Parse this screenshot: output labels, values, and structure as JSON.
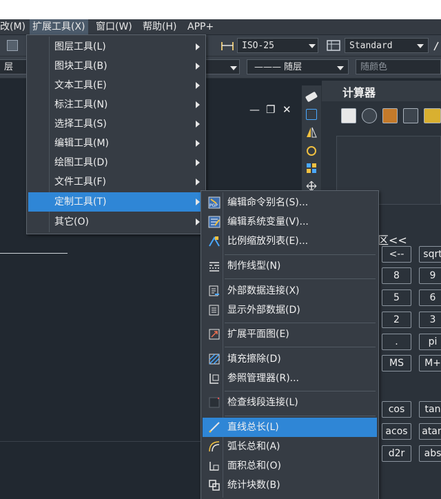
{
  "menubar": {
    "items": [
      "改(M)",
      "扩展工具(X)",
      "窗口(W)",
      "帮助(H)",
      "APP+"
    ]
  },
  "toolbar": {
    "dimstyle": "ISO-25",
    "textstyle": "Standard",
    "layer": "层",
    "linetype": "——— 随层",
    "color": "随颜色"
  },
  "window_controls": {
    "minimize": "—",
    "restore": "❐",
    "close": "✕"
  },
  "ext_menu": {
    "items": [
      {
        "label": "图层工具(L)",
        "has_submenu": true
      },
      {
        "label": "图块工具(B)",
        "has_submenu": true
      },
      {
        "label": "文本工具(E)",
        "has_submenu": true
      },
      {
        "label": "标注工具(N)",
        "has_submenu": true
      },
      {
        "label": "选择工具(S)",
        "has_submenu": true
      },
      {
        "label": "编辑工具(M)",
        "has_submenu": true
      },
      {
        "label": "绘图工具(D)",
        "has_submenu": true
      },
      {
        "label": "文件工具(F)",
        "has_submenu": true
      },
      {
        "label": "定制工具(T)",
        "has_submenu": true,
        "highlighted": true
      },
      {
        "label": "其它(O)",
        "has_submenu": true
      }
    ]
  },
  "custom_menu": {
    "items": [
      {
        "label": "编辑命令别名(S)...",
        "icon": "pgp-icon"
      },
      {
        "label": "编辑系统变量(V)...",
        "icon": "sysvar-icon"
      },
      {
        "label": "比例缩放列表(E)...",
        "icon": "scale-list-icon"
      },
      {
        "label": "制作线型(N)",
        "icon": "linetype-icon"
      },
      {
        "label": "外部数据连接(X)",
        "icon": "data-link-icon"
      },
      {
        "label": "显示外部数据(D)",
        "icon": "show-data-icon"
      },
      {
        "label": "扩展平面图(E)",
        "icon": "expand-plan-icon"
      },
      {
        "label": "填充擦除(D)",
        "icon": "hatch-erase-icon"
      },
      {
        "label": "参照管理器(R)...",
        "icon": "xref-manager-icon"
      },
      {
        "label": "检查线段连接(L)",
        "icon": "check-lines-icon"
      },
      {
        "label": "直线总长(L)",
        "icon": "line-length-icon",
        "highlighted": true
      },
      {
        "label": "弧长总和(A)",
        "icon": "arc-length-icon"
      },
      {
        "label": "面积总和(O)",
        "icon": "area-sum-icon"
      },
      {
        "label": "统计块数(B)",
        "icon": "block-count-icon"
      }
    ]
  },
  "calculator": {
    "title": "计算器",
    "expand_label": "区<<",
    "buttons": [
      [
        "<--",
        "sqrt"
      ],
      [
        "8",
        "9"
      ],
      [
        "5",
        "6"
      ],
      [
        "2",
        "3"
      ],
      [
        ".",
        "pi"
      ],
      [
        "MS",
        "M+"
      ],
      [
        "cos",
        "tan"
      ],
      [
        "acos",
        "atan"
      ],
      [
        "d2r",
        "abs"
      ]
    ]
  },
  "colors": {
    "menu_bg": "#363c44",
    "highlight": "#2f86d6",
    "app_bg": "#212830"
  }
}
